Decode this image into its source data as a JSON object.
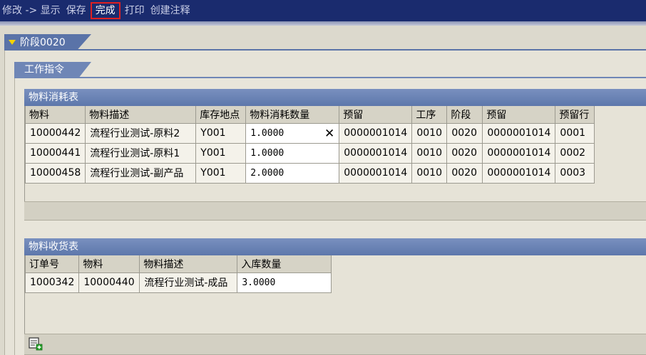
{
  "toolbar": {
    "modify": "修改 -> 显示",
    "save": "保存",
    "complete": "完成",
    "print": "打印",
    "create_note": "创建注释"
  },
  "stage": {
    "title": "阶段0020"
  },
  "work_order": {
    "title": "工作指令"
  },
  "consumption": {
    "title": "物料消耗表",
    "columns": [
      "物料",
      "物料描述",
      "库存地点",
      "物料消耗数量",
      "预留",
      "工序",
      "阶段",
      "预留",
      "预留行"
    ],
    "rows": [
      [
        "10000442",
        "流程行业测试-原料2",
        "Y001",
        "1.0000",
        "0000001014",
        "0010",
        "0020",
        "0000001014",
        "0001"
      ],
      [
        "10000441",
        "流程行业测试-原料1",
        "Y001",
        "1.0000",
        "0000001014",
        "0010",
        "0020",
        "0000001014",
        "0002"
      ],
      [
        "10000458",
        "流程行业测试-副产品",
        "Y001",
        "2.0000",
        "0000001014",
        "0010",
        "0020",
        "0000001014",
        "0003"
      ]
    ],
    "clear_glyph": "✕"
  },
  "receipt": {
    "title": "物料收货表",
    "columns": [
      "订单号",
      "物料",
      "物料描述",
      "入库数量"
    ],
    "rows": [
      [
        "1000342",
        "10000440",
        "流程行业测试-成品",
        "3.0000"
      ]
    ]
  },
  "icons": {
    "stage_toggle": "triangle-down-icon",
    "add_row": "add-row-icon"
  }
}
